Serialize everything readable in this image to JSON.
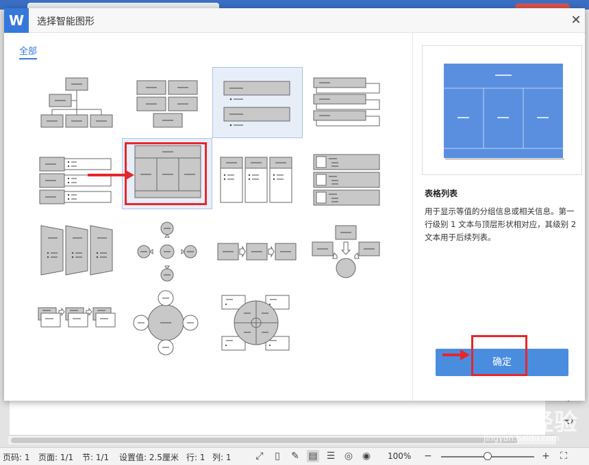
{
  "dialog": {
    "title": "选择智能图形",
    "logo": "W",
    "close_icon": "close-icon",
    "category_tab": "全部"
  },
  "preview": {
    "name": "表格列表",
    "description": "用于显示等值的分组信息或相关信息。第一行级别 1 文本与顶层形状相对应，其级别 2 文本用于后续列表。",
    "ok_label": "确定",
    "accent": "#5a8fe0"
  },
  "statusbar": {
    "page_num": "页码: 1",
    "pages": "页面: 1/1",
    "section": "节: 1/1",
    "setting": "设置值: 2.5厘米",
    "row": "行: 1",
    "col": "列: 1",
    "zoom": "100%",
    "zoom_minus": "−",
    "zoom_plus": "+"
  },
  "watermark": {
    "brand": "Baidu经验",
    "url": "jingyan.baidu.com"
  },
  "colors": {
    "accent_blue": "#3478db",
    "ok_button": "#4a8ddf",
    "highlight_red": "#e8262a",
    "shape_gray": "#c8c8c8"
  }
}
